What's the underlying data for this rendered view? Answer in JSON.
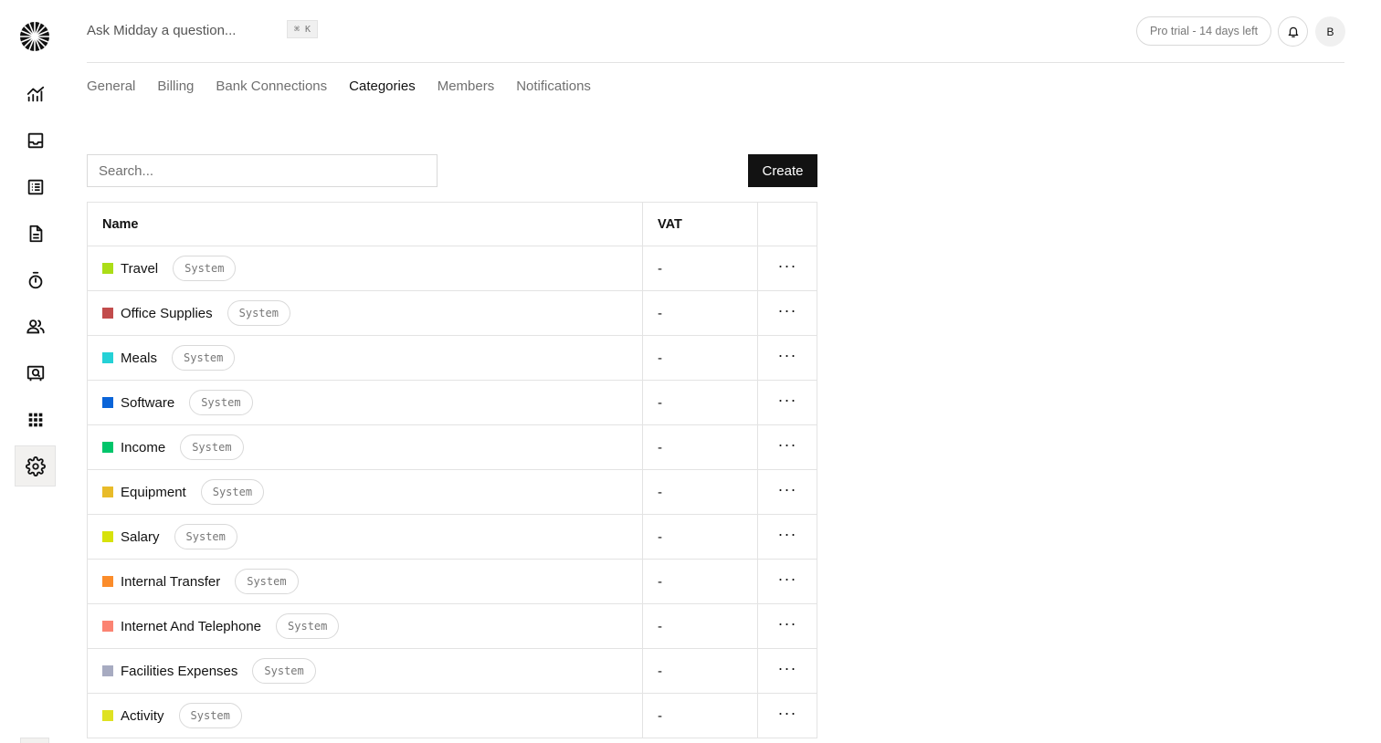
{
  "header": {
    "search_prompt": "Ask Midday a question...",
    "shortcut": "⌘ K",
    "trial_label": "Pro trial - 14 days left",
    "avatar_initial": "B"
  },
  "tabs": [
    {
      "label": "General",
      "active": false
    },
    {
      "label": "Billing",
      "active": false
    },
    {
      "label": "Bank Connections",
      "active": false
    },
    {
      "label": "Categories",
      "active": true
    },
    {
      "label": "Members",
      "active": false
    },
    {
      "label": "Notifications",
      "active": false
    }
  ],
  "toolbar": {
    "search_placeholder": "Search...",
    "create_label": "Create"
  },
  "table": {
    "columns": [
      "Name",
      "VAT",
      ""
    ],
    "rows": [
      {
        "name": "Travel",
        "badge": "System",
        "vat": "-",
        "color": "#abdd17"
      },
      {
        "name": "Office Supplies",
        "badge": "System",
        "vat": "-",
        "color": "#c24c4c"
      },
      {
        "name": "Meals",
        "badge": "System",
        "vat": "-",
        "color": "#25d1d6"
      },
      {
        "name": "Software",
        "badge": "System",
        "vat": "-",
        "color": "#0a64d8"
      },
      {
        "name": "Income",
        "badge": "System",
        "vat": "-",
        "color": "#00c56a"
      },
      {
        "name": "Equipment",
        "badge": "System",
        "vat": "-",
        "color": "#e8bb29"
      },
      {
        "name": "Salary",
        "badge": "System",
        "vat": "-",
        "color": "#d7e20b"
      },
      {
        "name": "Internal Transfer",
        "badge": "System",
        "vat": "-",
        "color": "#fb8c2a"
      },
      {
        "name": "Internet And Telephone",
        "badge": "System",
        "vat": "-",
        "color": "#fb8372"
      },
      {
        "name": "Facilities Expenses",
        "badge": "System",
        "vat": "-",
        "color": "#a7abc1"
      },
      {
        "name": "Activity",
        "badge": "System",
        "vat": "-",
        "color": "#dfe222"
      }
    ],
    "more_label": "···"
  },
  "sidebar": {
    "items": [
      {
        "icon": "chart-icon"
      },
      {
        "icon": "inbox-icon"
      },
      {
        "icon": "transactions-icon"
      },
      {
        "icon": "invoice-icon"
      },
      {
        "icon": "timer-icon"
      },
      {
        "icon": "customers-icon"
      },
      {
        "icon": "vault-icon"
      },
      {
        "icon": "apps-icon"
      },
      {
        "icon": "settings-icon",
        "active": true
      }
    ]
  }
}
